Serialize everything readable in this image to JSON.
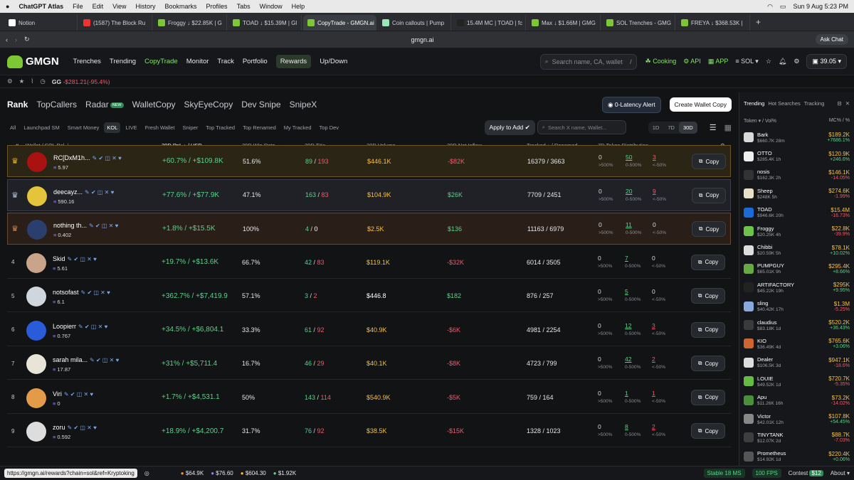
{
  "mac": {
    "app": "ChatGPT Atlas",
    "menus": [
      "File",
      "Edit",
      "View",
      "History",
      "Bookmarks",
      "Profiles",
      "Tabs",
      "Window",
      "Help"
    ],
    "datetime": "Sun 9 Aug  5:23 PM"
  },
  "tabs": [
    "Notion",
    "(1587) The Block Ru",
    "Froggy ↓ $22.85K | G",
    "TOAD ↓ $15.39M | Gl",
    "CopyTrade - GMGN.ai",
    "Coin callouts | Pump",
    "15.4M MC | TOAD | fc",
    "Max ↓ $1.66M | GMG",
    "SOL Trenches - GMG",
    "FREYA ↓ $368.53K |"
  ],
  "url": "gmgn.ai",
  "ask_chat": "Ask Chat",
  "nav": {
    "brand": "GMGN",
    "items": [
      "Trenches",
      "Trending",
      "CopyTrade",
      "Monitor",
      "Track",
      "Portfolio",
      "Rewards",
      "Up/Down"
    ],
    "search_placeholder": "Search name, CA, wallet",
    "search_key": "/",
    "cooking": "Cooking",
    "api": "API",
    "app": "APP",
    "chain": "SOL",
    "balance": "39.05"
  },
  "substrip": {
    "gg": "GG",
    "gg_val": "-$281.21(-95.4%)"
  },
  "toptabs": [
    "Rank",
    "TopCallers",
    "Radar",
    "WalletCopy",
    "SkyEyeCopy",
    "Dev Snipe",
    "SnipeX"
  ],
  "new_badge": "NEW",
  "latency_btn": "0-Latency Alert",
  "create_btn": "Create Wallet Copy",
  "filters": [
    "All",
    "Launchpad SM",
    "Smart Money",
    "KOL",
    "LIVE",
    "Fresh Wallet",
    "Sniper",
    "Top Tracked",
    "Top Renamed",
    "My Tracked",
    "Top Dev"
  ],
  "apply_add": "Apply to Add",
  "x_search": "Search X name, Wallet...",
  "periods": [
    "1D",
    "7D",
    "30D"
  ],
  "headers": {
    "hash": "#",
    "wallet": "Wallet / SOL Bal ⇣",
    "pnl": "30D PnL ↓ / USD",
    "wr": "30D Win Rate",
    "tx": "30D TXs",
    "vol": "30D Volume",
    "inflow": "30D Net Inflow",
    "tracked": "Tracked ↓ / Renamed",
    "dist": "7D Token Distribution"
  },
  "rows": [
    {
      "rank": "",
      "name": "RC[DxM1h...",
      "bal": "5.97",
      "pnl": "+60.7% / +$109.8K",
      "wr": "51.6%",
      "buy": "89",
      "sell": "193",
      "vol": "$446.1K",
      "inflow": "-$82K",
      "tracked": "16379 / 3663",
      "d1": "0",
      "d2": "50",
      "d3": "3"
    },
    {
      "rank": "",
      "name": "deecayz...",
      "bal": "590.16",
      "pnl": "+77.6% / +$77.9K",
      "wr": "47.1%",
      "buy": "163",
      "sell": "83",
      "vol": "$104.9K",
      "inflow": "$26K",
      "tracked": "7709 / 2451",
      "d1": "0",
      "d2": "20",
      "d3": "9"
    },
    {
      "rank": "",
      "name": "nothing th...",
      "bal": "0.402",
      "pnl": "+1.8% / +$15.5K",
      "wr": "100%",
      "buy": "4",
      "sell": "0",
      "vol": "$2.5K",
      "inflow": "$136",
      "tracked": "11163 / 6979",
      "d1": "0",
      "d2": "11",
      "d3": "0"
    },
    {
      "rank": "4",
      "name": "Skid",
      "bal": "5.61",
      "pnl": "+19.7% / +$13.6K",
      "wr": "66.7%",
      "buy": "42",
      "sell": "83",
      "vol": "$119.1K",
      "inflow": "-$32K",
      "tracked": "6014 / 3505",
      "d1": "0",
      "d2": "7",
      "d3": "0"
    },
    {
      "rank": "5",
      "name": "notsofast",
      "bal": "6.1",
      "pnl": "+362.7% / +$7,419.9",
      "wr": "57.1%",
      "buy": "3",
      "sell": "2",
      "vol": "$446.8",
      "inflow": "$182",
      "tracked": "876 / 257",
      "d1": "0",
      "d2": "5",
      "d3": "0"
    },
    {
      "rank": "6",
      "name": "Loopierr",
      "bal": "0.767",
      "pnl": "+34.5% / +$6,804.1",
      "wr": "33.3%",
      "buy": "61",
      "sell": "92",
      "vol": "$40.9K",
      "inflow": "-$6K",
      "tracked": "4981 / 2254",
      "d1": "0",
      "d2": "12",
      "d3": "3"
    },
    {
      "rank": "7",
      "name": "sarah mila...",
      "bal": "17.87",
      "pnl": "+31% / +$5,711.4",
      "wr": "16.7%",
      "buy": "46",
      "sell": "29",
      "vol": "$40.1K",
      "inflow": "-$8K",
      "tracked": "4723 / 799",
      "d1": "0",
      "d2": "42",
      "d3": "2"
    },
    {
      "rank": "8",
      "name": "Viri",
      "bal": "0",
      "pnl": "+1.7% / +$4,531.1",
      "wr": "50%",
      "buy": "143",
      "sell": "114",
      "vol": "$540.9K",
      "inflow": "-$5K",
      "tracked": "759 / 164",
      "d1": "0",
      "d2": "1",
      "d3": "1"
    },
    {
      "rank": "9",
      "name": "zoru",
      "bal": "0.592",
      "pnl": "+18.9% / +$4,200.7",
      "wr": "31.7%",
      "buy": "76",
      "sell": "92",
      "vol": "$38.5K",
      "inflow": "-$15K",
      "tracked": "1328 / 1023",
      "d1": "0",
      "d2": "8",
      "d3": "2"
    }
  ],
  "dist_labels": [
    ">500%",
    "0-500%",
    "<-50%"
  ],
  "copy_label": "Copy",
  "side": {
    "tabs": [
      "Trending",
      "Hot Searches",
      "Tracking"
    ],
    "h_token": "Token ▾ / Vol%",
    "h_mc": "MC% / %",
    "tokens": [
      {
        "n": "Bark",
        "v": "$660.7K",
        "t": "28m",
        "mc": "$189.2K",
        "p": "+7686.1%"
      },
      {
        "n": "OTTO",
        "v": "$285.4K",
        "t": "1h",
        "mc": "$120.9K",
        "p": "+246.6%"
      },
      {
        "n": "nosis",
        "v": "$162.3K",
        "t": "2h",
        "mc": "$146.1K",
        "p": "-14.05%"
      },
      {
        "n": "Sheep",
        "v": "$248K",
        "t": "5h",
        "mc": "$274.6K",
        "p": "-1.99%"
      },
      {
        "n": "TOAD",
        "v": "$946.6K",
        "t": "20h",
        "mc": "$15.4M",
        "p": "-16.73%"
      },
      {
        "n": "Froggy",
        "v": "$20.25K",
        "t": "4h",
        "mc": "$22.8K",
        "p": "-39.9%"
      },
      {
        "n": "Chibbi",
        "v": "$20.59K",
        "t": "5h",
        "mc": "$78.1K",
        "p": "+10.02%"
      },
      {
        "n": "PUMPGUY",
        "v": "$65.01K",
        "t": "9h",
        "mc": "$295.4K",
        "p": "+8.66%"
      },
      {
        "n": "ARTIFACTORY",
        "v": "$45.22K",
        "t": "19h",
        "mc": "$295K",
        "p": "+9.95%"
      },
      {
        "n": "sling",
        "v": "$40.42K",
        "t": "17h",
        "mc": "$1.3M",
        "p": "-5.25%"
      },
      {
        "n": "claudius",
        "v": "$83.18K",
        "t": "1d",
        "mc": "$520.2K",
        "p": "+36.43%"
      },
      {
        "n": "KIO",
        "v": "$36.49K",
        "t": "4d",
        "mc": "$765.6K",
        "p": "+3.06%"
      },
      {
        "n": "Dealer",
        "v": "$106.5K",
        "t": "3d",
        "mc": "$947.1K",
        "p": "-18.6%"
      },
      {
        "n": "LOUIE",
        "v": "$49.52K",
        "t": "1d",
        "mc": "$720.7K",
        "p": "-5.35%"
      },
      {
        "n": "Apu",
        "v": "$11.26K",
        "t": "16h",
        "mc": "$73.2K",
        "p": "-14.02%"
      },
      {
        "n": "Victor",
        "v": "$42.01K",
        "t": "12h",
        "mc": "$107.8K",
        "p": "+54.45%"
      },
      {
        "n": "TINYTANK",
        "v": "$12.07K",
        "t": "2d",
        "mc": "$88.7K",
        "p": "-7.03%"
      },
      {
        "n": "Prometheus",
        "v": "$14.92K",
        "t": "1d",
        "mc": "$220.4K",
        "p": "+0.06%"
      }
    ]
  },
  "status": {
    "link": "https://gmgn.ai/rewards?chain=sol&ref=Kryptoking",
    "c1": "$64.9K",
    "c2": "$76.60",
    "c3": "$604.30",
    "c4": "$1.92K",
    "stable": "Stable  18 MS",
    "fps": "100 FPS",
    "contest": "Contest",
    "contest_n": "$12",
    "about": "About"
  },
  "colors": {
    "accent": "#86e06b",
    "pnl_green": "#5bd18a",
    "neg_red": "#ef5b6d",
    "vol_yellow": "#f4c04e"
  }
}
